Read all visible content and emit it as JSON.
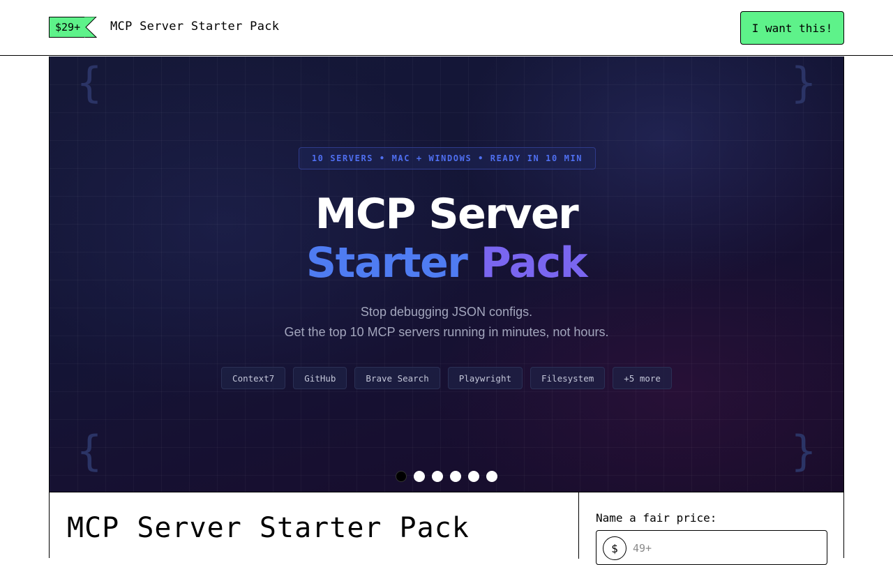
{
  "header": {
    "price_tag": "$29+",
    "product_name": "MCP Server Starter Pack",
    "cta_label": "I want this!"
  },
  "hero": {
    "badge": "10 SERVERS • MAC + WINDOWS • READY IN 10 MIN",
    "title_line1": "MCP Server",
    "title_line2_part1": "Starter",
    "title_line2_part2": "Pack",
    "subtitle_line1": "Stop debugging JSON configs.",
    "subtitle_line2": "Get the top 10 MCP servers running in minutes, not hours.",
    "chips": [
      "Context7",
      "GitHub",
      "Brave Search",
      "Playwright",
      "Filesystem",
      "+5 more"
    ],
    "braces": {
      "open": "{",
      "close": "}"
    },
    "carousel": {
      "count": 6,
      "active_index": 0
    }
  },
  "content": {
    "title": "MCP Server Starter Pack",
    "price_label": "Name a fair price:",
    "currency_symbol": "$",
    "price_placeholder": "49+"
  },
  "colors": {
    "accent_green": "#5ef28a",
    "hero_blue": "#4f7cf2",
    "hero_purple": "#7a66f0",
    "badge_text": "#4f6ff0"
  }
}
